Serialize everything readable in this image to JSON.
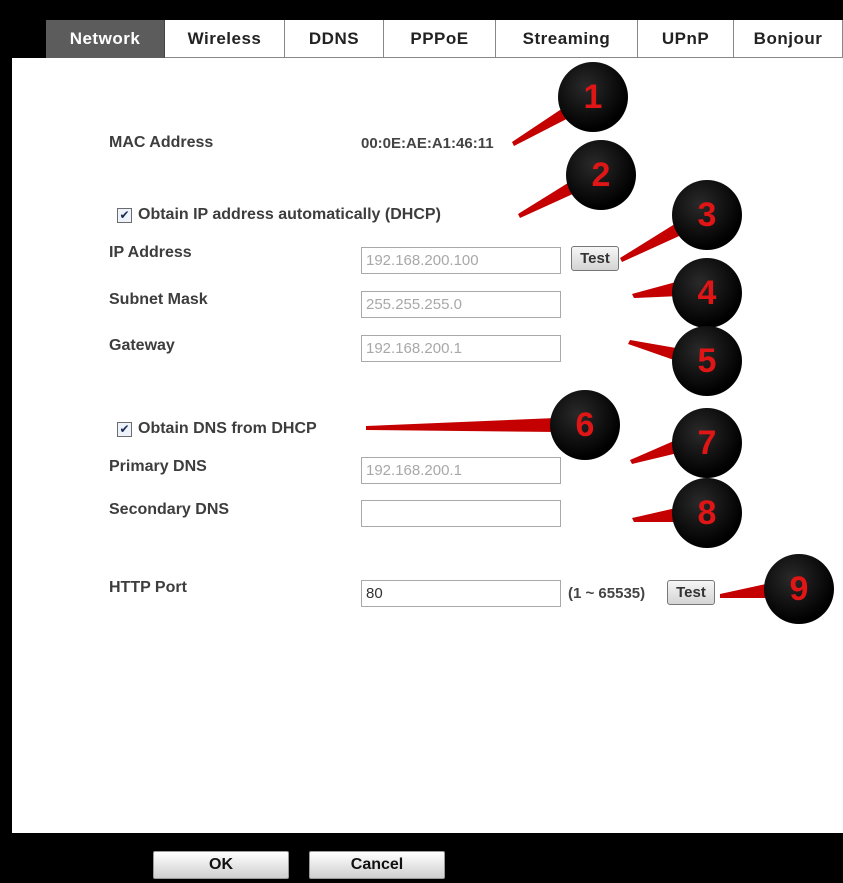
{
  "tabs": [
    {
      "label": "Network",
      "active": true
    },
    {
      "label": "Wireless",
      "active": false
    },
    {
      "label": "DDNS",
      "active": false
    },
    {
      "label": "PPPoE",
      "active": false
    },
    {
      "label": "Streaming",
      "active": false
    },
    {
      "label": "UPnP",
      "active": false
    },
    {
      "label": "Bonjour",
      "active": false
    }
  ],
  "mac": {
    "label": "MAC Address",
    "value": "00:0E:AE:A1:46:11"
  },
  "dhcp_ip": {
    "label": "Obtain IP address automatically (DHCP)",
    "checked": true
  },
  "ip_address": {
    "label": "IP Address",
    "value": "192.168.200.100",
    "test_label": "Test"
  },
  "subnet_mask": {
    "label": "Subnet Mask",
    "value": "255.255.255.0"
  },
  "gateway": {
    "label": "Gateway",
    "value": "192.168.200.1"
  },
  "dhcp_dns": {
    "label": "Obtain DNS from DHCP",
    "checked": true
  },
  "primary_dns": {
    "label": "Primary DNS",
    "value": "192.168.200.1"
  },
  "secondary_dns": {
    "label": "Secondary DNS",
    "value": ""
  },
  "http_port": {
    "label": "HTTP Port",
    "value": "80",
    "range": "(1 ~ 65535)",
    "test_label": "Test"
  },
  "footer": {
    "ok_label": "OK",
    "cancel_label": "Cancel"
  },
  "callouts": [
    "1",
    "2",
    "3",
    "4",
    "5",
    "6",
    "7",
    "8",
    "9"
  ],
  "colors": {
    "callout_text": "#e01515",
    "callout_line": "#cc0000",
    "active_tab": "#5c5c5c"
  }
}
